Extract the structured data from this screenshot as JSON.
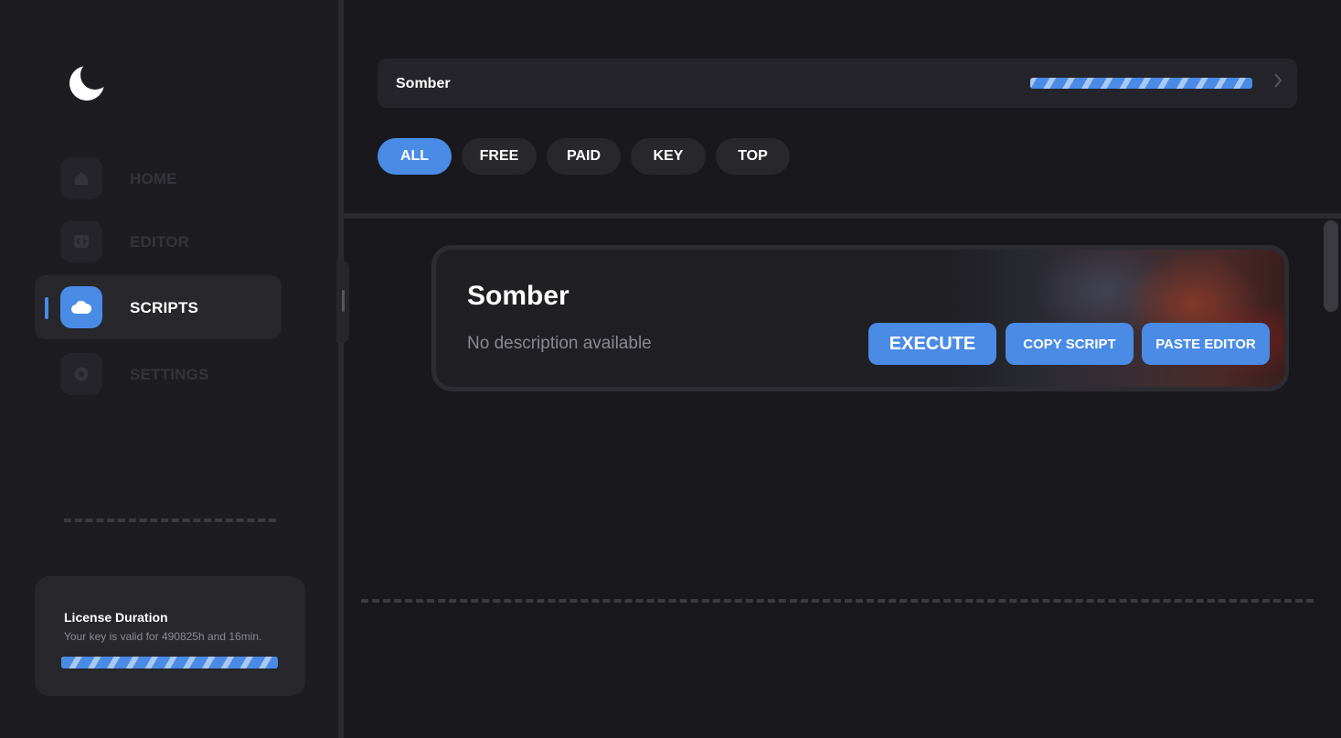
{
  "app": {
    "logo_icon": "crescent-moon-icon"
  },
  "colors": {
    "accent": "#4a8be6",
    "background": "#19191d",
    "panel": "#27272c"
  },
  "sidebar": {
    "items": [
      {
        "label": "HOME",
        "icon": "home-icon",
        "active": false
      },
      {
        "label": "EDITOR",
        "icon": "code-icon",
        "active": false
      },
      {
        "label": "SCRIPTS",
        "icon": "cloud-icon",
        "active": true
      },
      {
        "label": "SETTINGS",
        "icon": "gear-icon",
        "active": false
      }
    ]
  },
  "license": {
    "title": "License Duration",
    "subtitle": "Your key is valid for 490825h and 16min."
  },
  "topbar": {
    "title": "Somber"
  },
  "filters": {
    "tabs": [
      {
        "label": "ALL",
        "active": true
      },
      {
        "label": "FREE",
        "active": false
      },
      {
        "label": "PAID",
        "active": false
      },
      {
        "label": "KEY",
        "active": false
      },
      {
        "label": "TOP",
        "active": false
      }
    ]
  },
  "script_card": {
    "title": "Somber",
    "description": "No description available",
    "execute_label": "EXECUTE",
    "copy_label": "COPY SCRIPT",
    "paste_label": "PASTE EDITOR"
  }
}
